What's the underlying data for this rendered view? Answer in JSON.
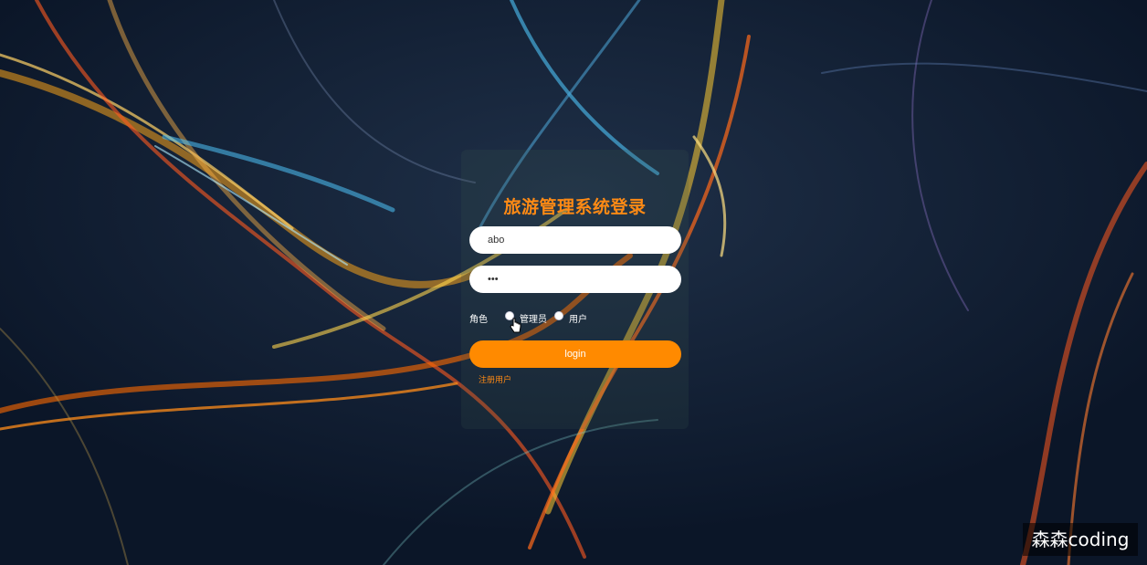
{
  "login": {
    "title": "旅游管理系统登录",
    "username_value": "abo",
    "password_value": "•••",
    "role_label": "角色",
    "role_options": [
      {
        "label": "管理员",
        "selected": false
      },
      {
        "label": "用户",
        "selected": false
      }
    ],
    "login_label": "login",
    "register_label": "注册用户"
  },
  "watermark": {
    "text": "森森coding"
  },
  "colors": {
    "accent": "#ff8a00",
    "background": "#0d1a2e"
  }
}
